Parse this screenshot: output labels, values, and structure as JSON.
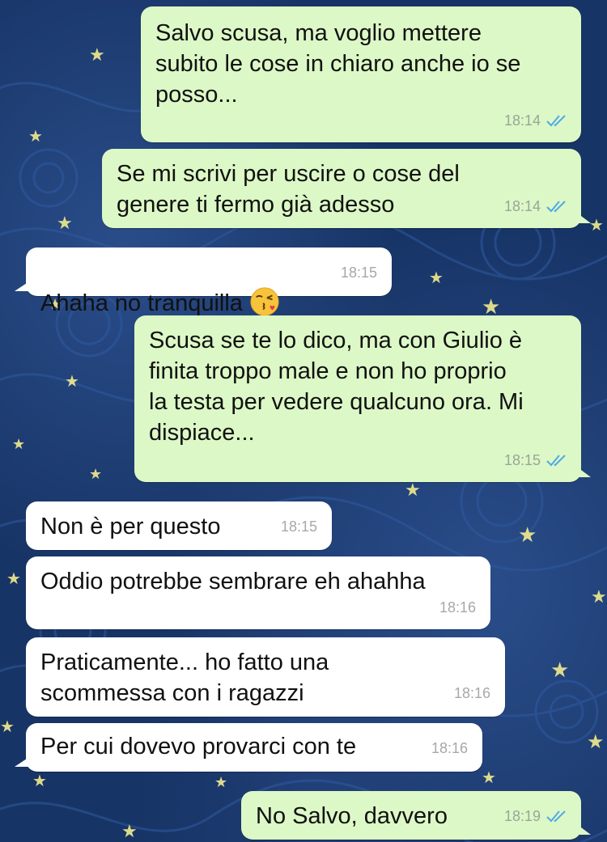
{
  "colors": {
    "background": "#173466",
    "outgoing_bubble": "#dcf8c6",
    "incoming_bubble": "#ffffff",
    "read_ticks": "#4fa9e6",
    "star": "#f2ec8e"
  },
  "messages": [
    {
      "direction": "outgoing",
      "text": "Salvo scusa, ma voglio mettere\nsubito le cose in chiaro anche io se\nposso...",
      "time": "18:14",
      "status": "read"
    },
    {
      "direction": "outgoing",
      "text": "Se mi scrivi per uscire o cose del\ngenere ti fermo già adesso",
      "time": "18:14",
      "status": "read"
    },
    {
      "direction": "incoming",
      "text": "Ahaha no tranquilla",
      "emoji": "face-throwing-kiss-emoji",
      "time": "18:15"
    },
    {
      "direction": "outgoing",
      "text": "Scusa se te lo dico, ma con Giulio è\nfinita troppo male e non ho proprio\nla testa per vedere qualcuno ora. Mi\ndispiace...",
      "time": "18:15",
      "status": "read"
    },
    {
      "direction": "incoming",
      "text": "Non è per questo",
      "time": "18:15"
    },
    {
      "direction": "incoming",
      "text": "Oddio potrebbe sembrare eh ahahha",
      "time": "18:16"
    },
    {
      "direction": "incoming",
      "text": "Praticamente... ho fatto una\nscommessa con i ragazzi",
      "time": "18:16"
    },
    {
      "direction": "incoming",
      "text": "Per cui dovevo provarci con te",
      "time": "18:16"
    },
    {
      "direction": "outgoing",
      "text": "No Salvo, davvero",
      "time": "18:19",
      "status": "read"
    }
  ]
}
